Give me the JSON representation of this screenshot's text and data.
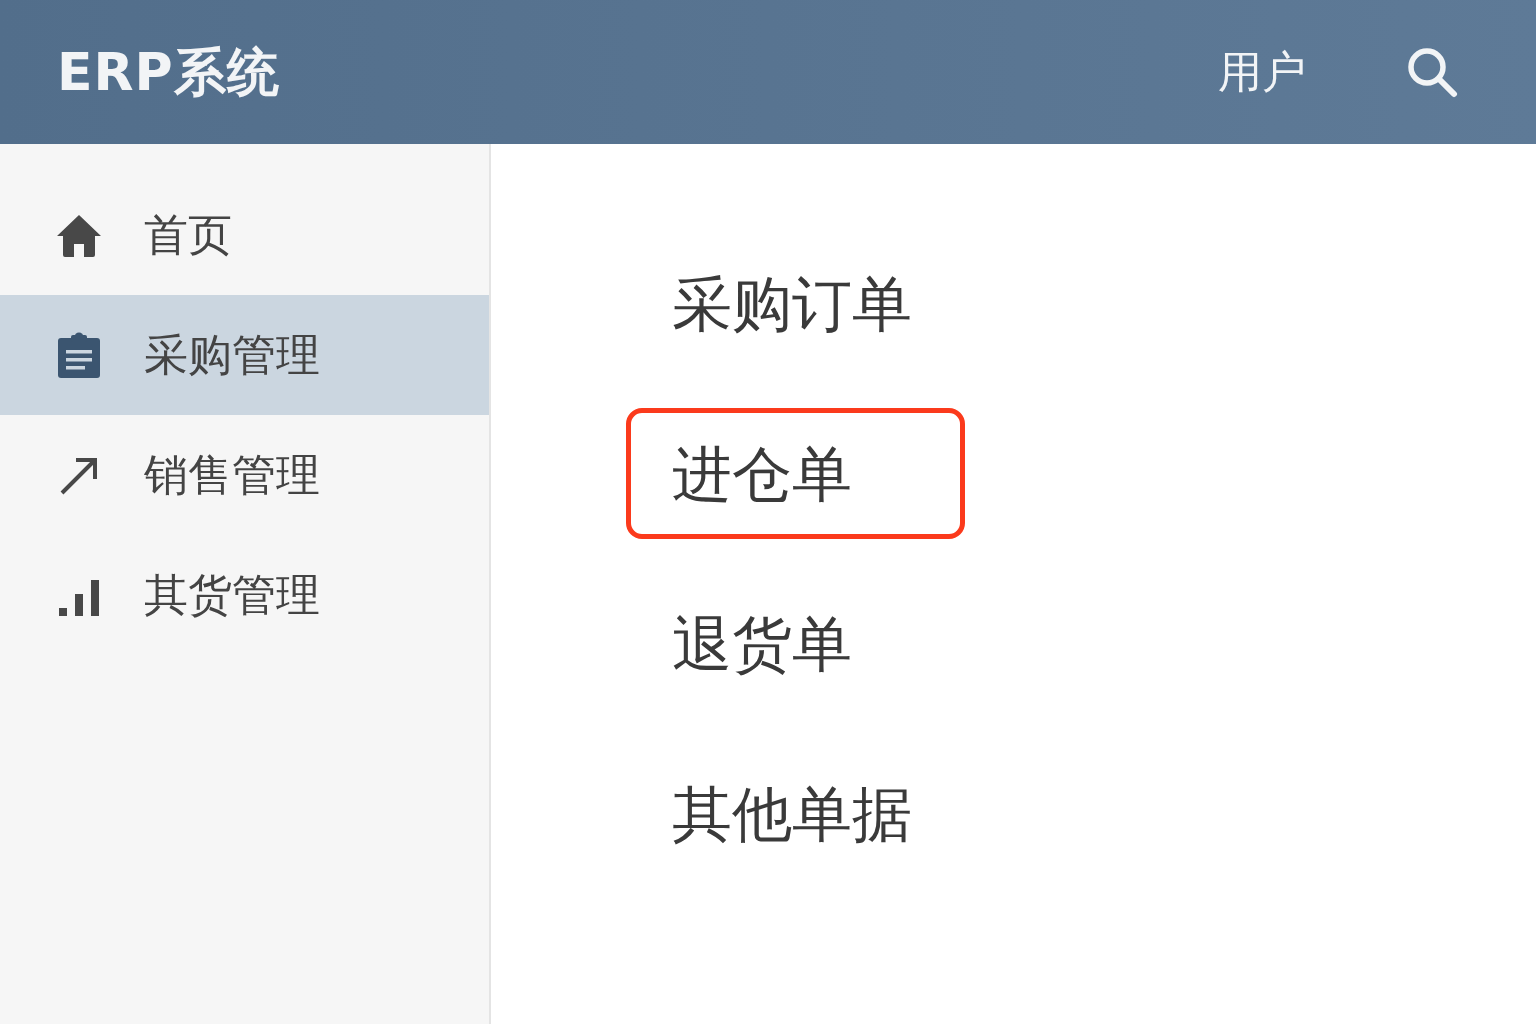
{
  "header": {
    "title": "ERP系统",
    "user": "用户"
  },
  "sidebar": {
    "items": [
      {
        "label": "首页",
        "selected": false
      },
      {
        "label": "采购管理",
        "selected": true
      },
      {
        "label": "销售管理",
        "selected": false
      },
      {
        "label": "其货管理",
        "selected": false
      }
    ]
  },
  "content": {
    "items": [
      {
        "label": "采购订单",
        "selected": false
      },
      {
        "label": "进仓单",
        "selected": true
      },
      {
        "label": "退货单",
        "selected": false
      },
      {
        "label": "其他单据",
        "selected": false
      }
    ]
  }
}
